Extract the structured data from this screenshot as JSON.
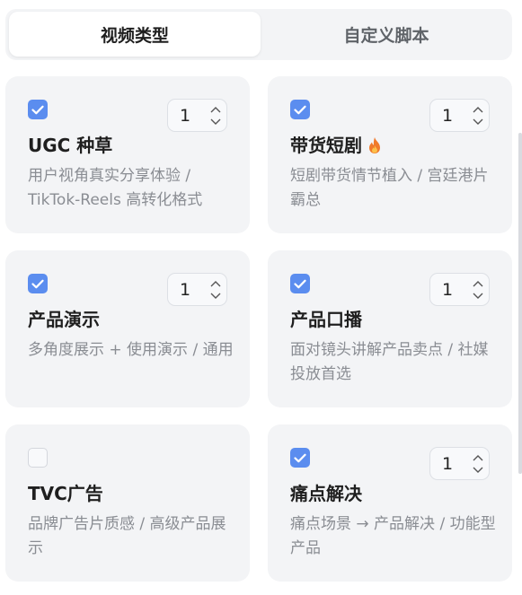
{
  "tabs": [
    {
      "label": "视频类型",
      "active": true
    },
    {
      "label": "自定义脚本",
      "active": false
    }
  ],
  "colors": {
    "checkbox_checked": "#5b8def",
    "card_bg": "#f3f4f6",
    "description": "#8a8d93"
  },
  "cards": [
    {
      "title": "UGC 种草",
      "description": "用户视角真实分享体验 / TikTok-Reels 高转化格式",
      "checked": true,
      "quantity": "1",
      "badge_icon": ""
    },
    {
      "title": "带货短剧",
      "description": "短剧带货情节植入 / 宫廷港片霸总",
      "checked": true,
      "quantity": "1",
      "badge_icon": "fire-icon"
    },
    {
      "title": "产品演示",
      "description": "多角度展示 + 使用演示 / 通用",
      "checked": true,
      "quantity": "1",
      "badge_icon": ""
    },
    {
      "title": "产品口播",
      "description": "面对镜头讲解产品卖点 / 社媒投放首选",
      "checked": true,
      "quantity": "1",
      "badge_icon": ""
    },
    {
      "title": "TVC广告",
      "description": "品牌广告片质感 / 高级产品展示",
      "checked": false,
      "quantity": "",
      "badge_icon": ""
    },
    {
      "title": "痛点解决",
      "description": "痛点场景 → 产品解决 / 功能型产品",
      "checked": true,
      "quantity": "1",
      "badge_icon": ""
    }
  ]
}
